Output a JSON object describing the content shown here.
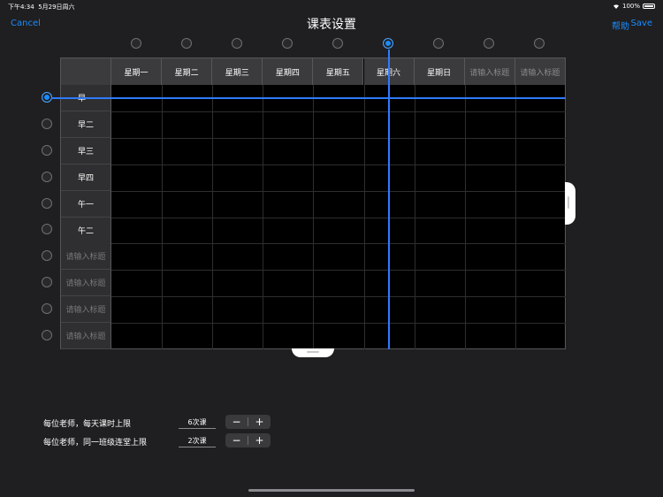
{
  "status": {
    "time": "下午4:34",
    "date": "5月29日周六",
    "battery": "100%"
  },
  "nav": {
    "cancel": "Cancel",
    "title": "课表设置",
    "help": "帮助",
    "save": "Save"
  },
  "columns": [
    "星期一",
    "星期二",
    "星期三",
    "星期四",
    "星期五",
    "星期六",
    "星期日",
    "请输入标题",
    "请输入标题"
  ],
  "columns_placeholder": [
    false,
    false,
    false,
    false,
    false,
    false,
    false,
    true,
    true
  ],
  "selected_column": 5,
  "rows": [
    "早一",
    "早二",
    "早三",
    "早四",
    "午一",
    "午二",
    "请输入标题",
    "请输入标题",
    "请输入标题",
    "请输入标题"
  ],
  "rows_placeholder": [
    false,
    false,
    false,
    false,
    false,
    false,
    true,
    true,
    true,
    true
  ],
  "selected_row": 0,
  "settings": [
    {
      "label": "每位老师，每天课时上限",
      "value": "6次课",
      "minus": "−",
      "plus": "+"
    },
    {
      "label": "每位老师，同一班级连堂上限",
      "value": "2次课",
      "minus": "−",
      "plus": "+"
    }
  ],
  "colors": {
    "accent": "#1a8cff",
    "background": "#1f1f21"
  }
}
